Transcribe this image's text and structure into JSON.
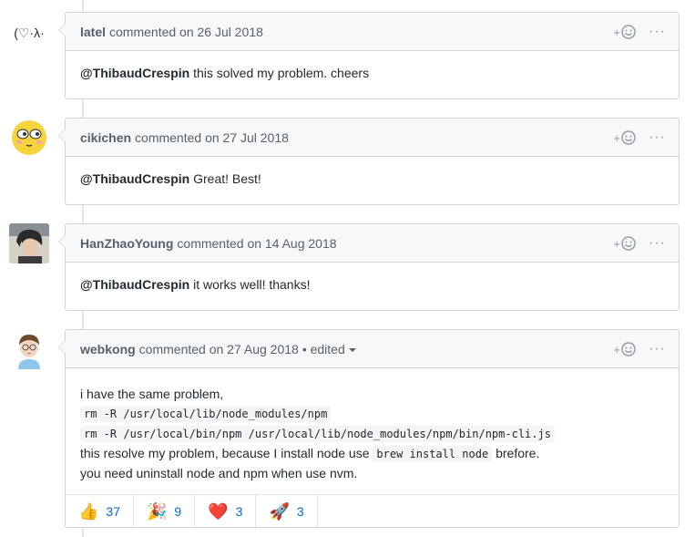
{
  "comments": [
    {
      "author": "latel",
      "meta": "commented on 26 Jul 2018",
      "avatar_text": "(♡·λ·",
      "mention": "@ThibaudCrespin",
      "text": " this solved my problem. cheers"
    },
    {
      "author": "cikichen",
      "meta": "commented on 27 Jul 2018",
      "mention": "@ThibaudCrespin",
      "text": " Great! Best!"
    },
    {
      "author": "HanZhaoYoung",
      "meta": "commented on 14 Aug 2018",
      "mention": "@ThibaudCrespin",
      "text": " it works well! thanks!"
    },
    {
      "author": "webkong",
      "meta": "commented on 27 Aug 2018",
      "edited": "• edited",
      "line1": "i have the same problem,",
      "code1": "rm -R /usr/local/lib/node_modules/npm",
      "code2": "rm -R /usr/local/bin/npm /usr/local/lib/node_modules/npm/bin/npm-cli.js",
      "line4_pre": "this resolve my problem, because I install node use ",
      "code3": "brew install node",
      "line4_post": " brefore.",
      "line5": "you need uninstall node and npm when use nvm.",
      "reactions": [
        {
          "emoji": "👍",
          "count": "37"
        },
        {
          "emoji": "🎉",
          "count": "9"
        },
        {
          "emoji": "❤️",
          "count": "3"
        },
        {
          "emoji": "🚀",
          "count": "3"
        }
      ]
    }
  ],
  "actions": {
    "plus": "+",
    "smiley": "☺",
    "more": "···"
  },
  "colors": {
    "header_bg": "#f6f8fa",
    "border": "#d1d5da",
    "link": "#0366d6",
    "muted": "#586069"
  }
}
